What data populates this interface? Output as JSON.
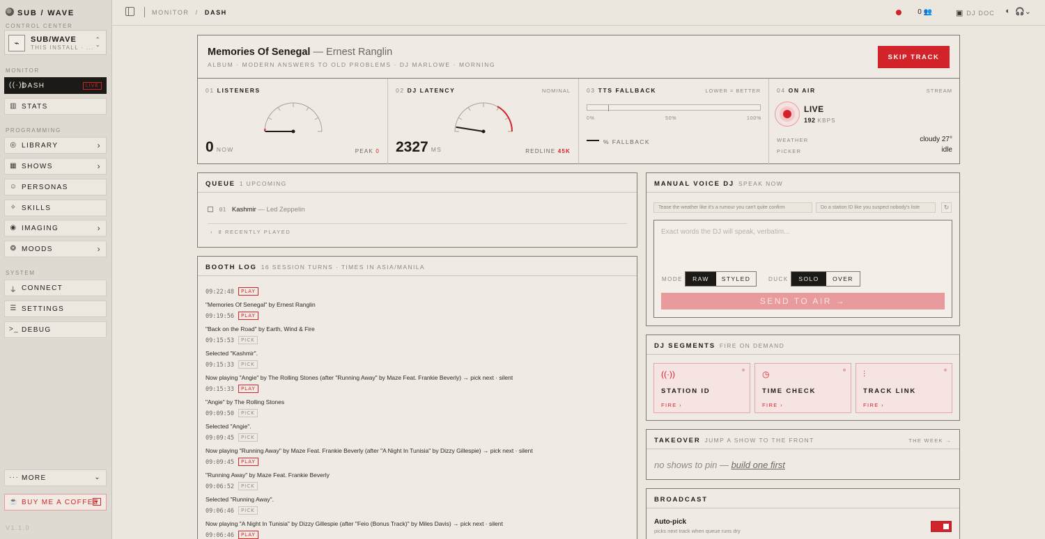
{
  "brand": {
    "name": "SUB / WAVE",
    "subtitle": "CONTROL CENTER"
  },
  "install": {
    "name": "SUB/WAVE",
    "detail": "THIS INSTALL · ..."
  },
  "sidebar": {
    "sections": {
      "monitor": "MONITOR",
      "programming": "PROGRAMMING",
      "system": "SYSTEM"
    },
    "monitor": [
      {
        "label": "DASH",
        "icon": "broadcast-icon",
        "badge": "LIVE"
      },
      {
        "label": "STATS",
        "icon": "bar-chart-icon"
      }
    ],
    "programming": [
      {
        "label": "LIBRARY",
        "icon": "disc-icon"
      },
      {
        "label": "SHOWS",
        "icon": "calendar-icon"
      },
      {
        "label": "PERSONAS",
        "icon": "mask-icon"
      },
      {
        "label": "SKILLS",
        "icon": "sparkle-icon"
      },
      {
        "label": "IMAGING",
        "icon": "antenna-icon"
      },
      {
        "label": "MOODS",
        "icon": "palette-icon"
      }
    ],
    "system": [
      {
        "label": "CONNECT",
        "icon": "plug-icon"
      },
      {
        "label": "SETTINGS",
        "icon": "sliders-icon"
      },
      {
        "label": "DEBUG",
        "icon": "terminal-icon"
      }
    ],
    "more": "MORE",
    "coffee": "BUY ME A COFFEE",
    "version": "V1.1.0"
  },
  "topbar": {
    "crumb_parent": "MONITOR",
    "crumb_sep": "/",
    "crumb_current": "DASH",
    "listener_count": "0",
    "dj_doc": "DJ DOC"
  },
  "now_playing": {
    "title": "Memories Of Senegal",
    "artist": "— Ernest Ranglin",
    "meta": "ALBUM · MODERN ANSWERS TO OLD PROBLEMS · DJ MARLOWE · MORNING",
    "skip": "SKIP TRACK"
  },
  "stats": {
    "listeners": {
      "num": "01",
      "label": "LISTENERS",
      "value": "0",
      "unit": "NOW",
      "peak_label": "PEAK",
      "peak": "0",
      "gauge_fraction": 0.0
    },
    "latency": {
      "num": "02",
      "label": "DJ LATENCY",
      "status": "NOMINAL",
      "value": "2327",
      "unit": "MS",
      "redline_label": "REDLINE",
      "redline": "45K",
      "gauge_fraction": 0.05
    },
    "tts": {
      "num": "03",
      "label": "TTS FALLBACK",
      "hint": "LOWER = BETTER",
      "ticks": [
        "0%",
        "50%",
        "100%"
      ],
      "value": "—",
      "legend": "% FALLBACK",
      "marker_fraction": 0.12
    },
    "onair": {
      "num": "04",
      "label": "ON AIR",
      "hint": "STREAM",
      "status": "LIVE",
      "kbps": "192",
      "kbps_unit": "KBPS",
      "weather_label": "WEATHER",
      "weather": "cloudy 27°",
      "picker_label": "PICKER",
      "picker": "idle"
    }
  },
  "queue": {
    "title": "QUEUE",
    "count": "1 UPCOMING",
    "items": [
      {
        "num": "01",
        "title": "Kashmir",
        "artist": "— Led Zeppelin"
      }
    ],
    "recent": "8 RECENTLY PLAYED"
  },
  "booth": {
    "title": "BOOTH LOG",
    "subtitle": "16 SESSION TURNS · TIMES IN ASIA/MANILA",
    "entries": [
      {
        "time": "09:22:48",
        "tag": "PLAY",
        "text": "\"Memories Of Senegal\" by Ernest Ranglin"
      },
      {
        "time": "09:19:56",
        "tag": "PLAY",
        "text": "\"Back on the Road\" by Earth, Wind & Fire"
      },
      {
        "time": "09:15:53",
        "tag": "PICK",
        "text": "Selected \"Kashmir\"."
      },
      {
        "time": "09:15:33",
        "tag": "PICK",
        "text": "Now playing \"Angie\" by The Rolling Stones (after \"Running Away\" by Maze Feat. Frankie Beverly) → pick next · silent"
      },
      {
        "time": "09:15:33",
        "tag": "PLAY",
        "text": "\"Angie\" by The Rolling Stones"
      },
      {
        "time": "09:09:50",
        "tag": "PICK",
        "text": "Selected \"Angie\"."
      },
      {
        "time": "09:09:45",
        "tag": "PICK",
        "text": "Now playing \"Running Away\" by Maze Feat. Frankie Beverly (after \"A Night In Tunisia\" by Dizzy Gillespie) → pick next · silent"
      },
      {
        "time": "09:09:45",
        "tag": "PLAY",
        "text": "\"Running Away\" by Maze Feat. Frankie Beverly"
      },
      {
        "time": "09:06:52",
        "tag": "PICK",
        "text": "Selected \"Running Away\"."
      },
      {
        "time": "09:06:46",
        "tag": "PICK",
        "text": "Now playing \"A Night In Tunisia\" by Dizzy Gillespie (after \"Feio (Bonus Track)\" by Miles Davis) → pick next · silent"
      },
      {
        "time": "09:06:46",
        "tag": "PLAY",
        "text": ""
      }
    ]
  },
  "voice": {
    "title": "MANUAL VOICE DJ",
    "subtitle": "SPEAK NOW",
    "chips": [
      "Tease the weather like it's a rumour you can't quite confirm",
      "Do a station ID like you suspect nobody's liste"
    ],
    "placeholder": "Exact words the DJ will speak, verbatim...",
    "mode_label": "MODE",
    "mode_options": [
      "RAW",
      "STYLED"
    ],
    "duck_label": "DUCK",
    "duck_options": [
      "SOLO",
      "OVER"
    ],
    "send": "SEND TO AIR →"
  },
  "segments": {
    "title": "DJ SEGMENTS",
    "subtitle": "FIRE ON DEMAND",
    "cards": [
      {
        "label": "STATION ID",
        "fire": "FIRE ›",
        "icon": "antenna-icon"
      },
      {
        "label": "TIME CHECK",
        "fire": "FIRE ›",
        "icon": "clock-icon"
      },
      {
        "label": "TRACK LINK",
        "fire": "FIRE ›",
        "icon": "waveform-icon"
      }
    ]
  },
  "takeover": {
    "title": "TAKEOVER",
    "subtitle": "JUMP A SHOW TO THE FRONT",
    "link": "THE WEEK →",
    "empty": "no shows to pin — ",
    "empty_link": "build one first"
  },
  "broadcast": {
    "title": "BROADCAST",
    "autopick_label": "Auto-pick",
    "autopick_sub": "picks next track when queue runs dry",
    "autopick_on": true
  },
  "colors": {
    "accent": "#d2232a",
    "background": "#ebe7df",
    "panel": "#efebe4",
    "ink": "#1c1a17"
  }
}
